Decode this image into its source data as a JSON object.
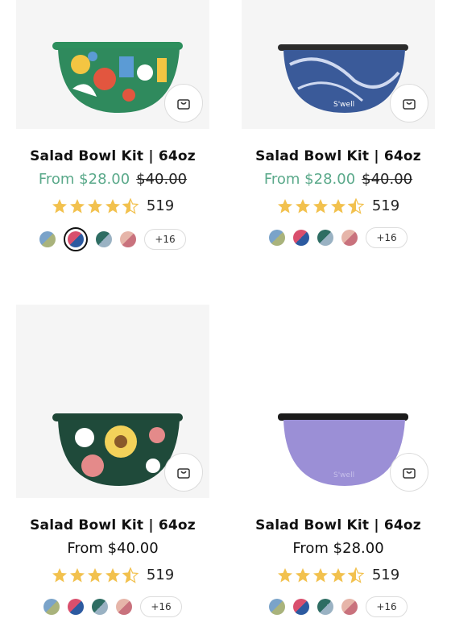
{
  "products": [
    {
      "title": "Salad Bowl Kit | 64oz",
      "price": "From $28.00",
      "compare_price": "$40.00",
      "rating": 4.5,
      "review_count": "519",
      "more_swatches": "+16",
      "bowl": {
        "body": "#2f8a5d",
        "lid": "#2d8f5d",
        "pattern": "floral-geometric",
        "colors": [
          "#2d8f5d",
          "#f4c542",
          "#e2563f",
          "#5b9bd5",
          "#ffffff"
        ]
      }
    },
    {
      "title": "Salad Bowl Kit | 64oz",
      "price": "From $28.00",
      "compare_price": "$40.00",
      "rating": 4.5,
      "review_count": "519",
      "more_swatches": "+16",
      "bowl": {
        "body": "#3a5a99",
        "lid": "#2b2b2b",
        "pattern": "marble",
        "logo": "S'well",
        "colors": [
          "#3a5a99",
          "#cfd9f0"
        ]
      }
    },
    {
      "title": "Salad Bowl Kit | 64oz",
      "price": "From $40.00",
      "rating": 4.5,
      "review_count": "519",
      "more_swatches": "+16",
      "bowl": {
        "body": "#1f4a3a",
        "lid": "#1e4636",
        "pattern": "flowers",
        "colors": [
          "#1f4a3a",
          "#f3d25a",
          "#e48a8a",
          "#ffffff"
        ]
      }
    },
    {
      "title": "Salad Bowl Kit | 64oz",
      "price": "From $28.00",
      "rating": 4.5,
      "review_count": "519",
      "more_swatches": "+16",
      "bowl": {
        "body": "#9b8fd6",
        "lid": "#1b1b1b",
        "pattern": "solid",
        "logo": "S'well",
        "colors": [
          "#9b8fd6"
        ]
      }
    }
  ],
  "swatch_colors": [
    [
      "#7aa3c9",
      "#a9b37c"
    ],
    [
      "#d94f6d",
      "#2c5aa0"
    ],
    [
      "#2e6d63",
      "#9ab2c3"
    ],
    [
      "#e6b5a9",
      "#c9727d"
    ]
  ],
  "colors": {
    "accent_price": "#5aa98a",
    "star": "#f2c14e",
    "star_empty": "#d9d9d9",
    "border": "#dcdcdc"
  },
  "icons": {
    "cart": "shopping-bag-icon",
    "star": "star-icon"
  }
}
